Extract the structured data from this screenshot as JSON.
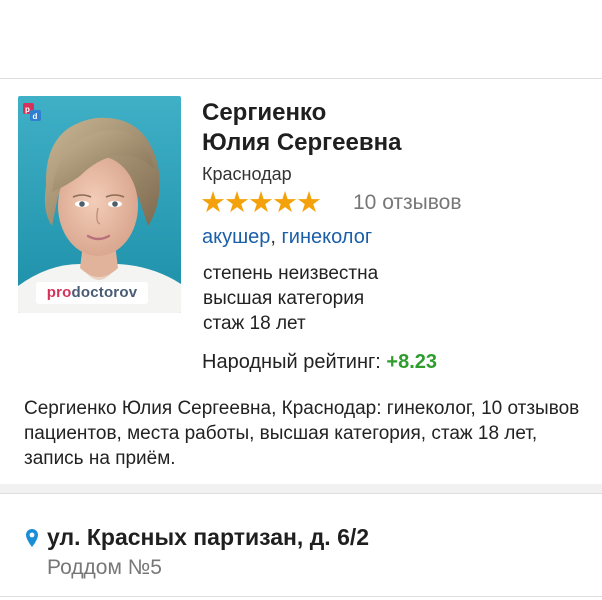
{
  "doctor": {
    "surname": "Сергиенко",
    "given_names": "Юлия Сергеевна",
    "city": "Краснодар",
    "rating_stars": 5,
    "reviews": "10 отзывов",
    "specialties": [
      "акушер",
      "гинеколог"
    ],
    "specialty_separator": ",",
    "degree": "степень неизвестна",
    "category": "высшая категория",
    "experience": "стаж 18 лет",
    "people_rating_label": "Народный рейтинг:",
    "people_rating_value": "+8.23",
    "photo_watermark": "prodoctorov",
    "description": "Сергиенко Юлия Сергеевна, Краснодар: гинеколог, 10 отзывов пациентов, места работы, высшая категория, стаж 18 лет, запись на приём."
  },
  "location": {
    "address": "ул. Красных партизан, д. 6/2",
    "place": "Роддом №5"
  },
  "icons": {
    "star": "star-icon",
    "pin": "location-pin-icon",
    "badge": "prodoctorov-badge-icon"
  },
  "colors": {
    "link": "#1b5fa8",
    "star": "#f4a20c",
    "rating_positive": "#2e9d2e",
    "pin": "#1a8fd8",
    "muted": "#777777"
  }
}
